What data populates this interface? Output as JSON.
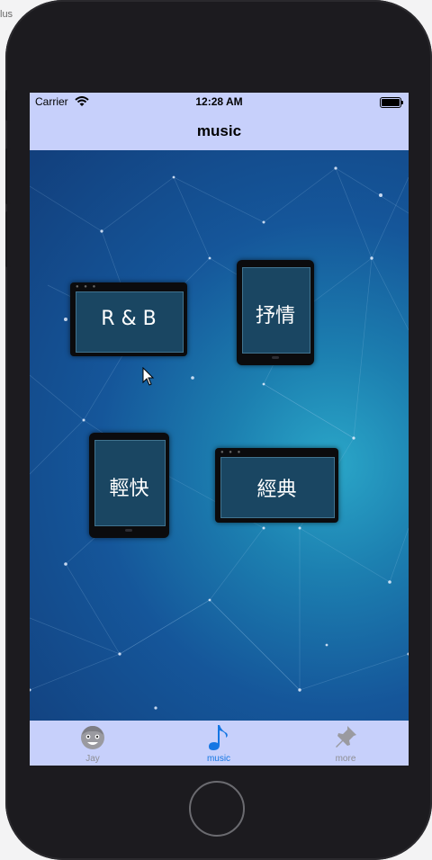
{
  "simulator": {
    "partial_label": "lus"
  },
  "status_bar": {
    "carrier": "Carrier",
    "time": "12:28 AM"
  },
  "nav": {
    "title": "music"
  },
  "categories": [
    {
      "label": "R & B"
    },
    {
      "label": "抒情"
    },
    {
      "label": "輕快"
    },
    {
      "label": "經典"
    }
  ],
  "tabs": [
    {
      "label": "Jay",
      "icon": "face-icon",
      "active": false
    },
    {
      "label": "music",
      "icon": "music-note-icon",
      "active": true
    },
    {
      "label": "more",
      "icon": "pin-icon",
      "active": false
    }
  ],
  "colors": {
    "bar_bg": "#c7d0fb",
    "tab_active": "#1476e3",
    "tab_inactive": "#8e8e93",
    "phone_body": "#1c1b1f"
  }
}
